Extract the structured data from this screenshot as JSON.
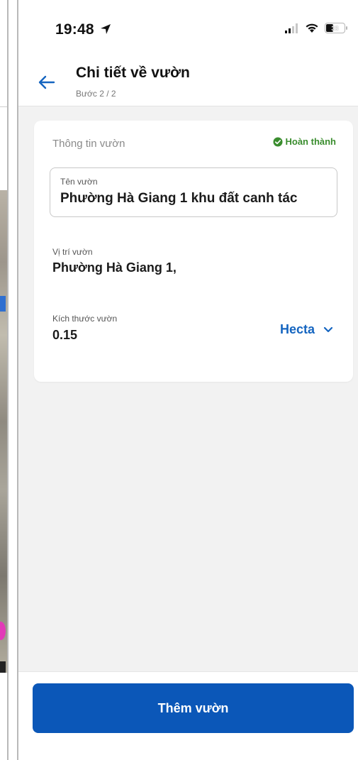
{
  "status_bar": {
    "time": "19:48",
    "battery": "33"
  },
  "header": {
    "title": "Chi tiết về vườn",
    "step": "Bước 2 / 2"
  },
  "card": {
    "section_label": "Thông tin vườn",
    "status": "Hoàn thành",
    "garden_name": {
      "label": "Tên vườn",
      "value": "Phường Hà Giang 1 khu đất canh tác"
    },
    "location": {
      "label": "Vị trí vườn",
      "value": "Phường Hà Giang 1,"
    },
    "size": {
      "label": "Kích thước vườn",
      "value": "0.15",
      "unit": "Hecta"
    }
  },
  "footer": {
    "primary_button": "Thêm vườn"
  },
  "colors": {
    "accent": "#0b57b8",
    "link": "#1565c0",
    "success": "#3a8d2e"
  },
  "icons": [
    "location-arrow-icon",
    "signal-icon",
    "wifi-icon",
    "battery-icon",
    "back-arrow-icon",
    "check-circle-icon",
    "chevron-down-icon"
  ]
}
